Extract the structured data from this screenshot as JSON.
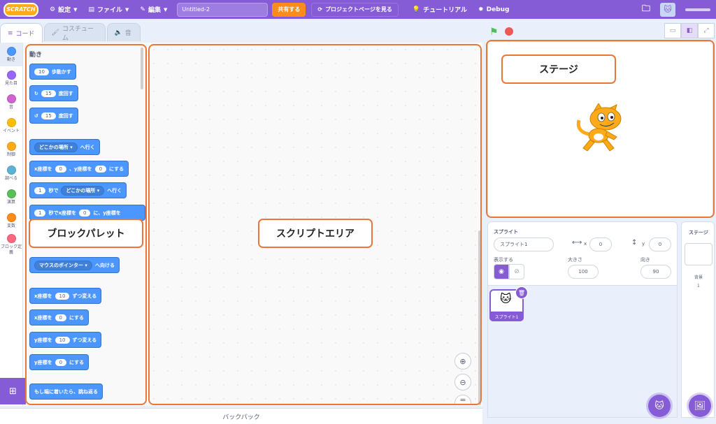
{
  "menubar": {
    "logo": "SCRATCH",
    "settings": "設定",
    "file": "ファイル",
    "edit": "編集",
    "project_title": "Untitled-2",
    "share": "共有する",
    "project_page": "プロジェクトページを見る",
    "tutorial": "チュートリアル",
    "debug": "Debug",
    "accent_color": "#855cd6"
  },
  "tabs": [
    {
      "label": "コード",
      "active": true
    },
    {
      "label": "コスチューム",
      "active": false
    },
    {
      "label": "音",
      "active": false
    }
  ],
  "categories": [
    {
      "label": "動き",
      "color": "#4c97ff"
    },
    {
      "label": "見た目",
      "color": "#9966ff"
    },
    {
      "label": "音",
      "color": "#cf63cf"
    },
    {
      "label": "イベント",
      "color": "#ffbf00"
    },
    {
      "label": "制御",
      "color": "#ffab19"
    },
    {
      "label": "調べる",
      "color": "#5cb1d6"
    },
    {
      "label": "演算",
      "color": "#59c059"
    },
    {
      "label": "変数",
      "color": "#ff8c1a"
    },
    {
      "label": "ブロック定義",
      "color": "#ff6680"
    }
  ],
  "palette": {
    "section_title": "動き",
    "blocks": {
      "move": {
        "value": "10",
        "text": "歩動かす"
      },
      "turn_right": {
        "value": "15",
        "text": "度回す"
      },
      "turn_left": {
        "value": "15",
        "text": "度回す"
      },
      "goto": {
        "drop": "どこかの場所",
        "text": "へ行く"
      },
      "goto_xy": {
        "pre": "x座標を",
        "x": "0",
        "mid": "、y座標を",
        "y": "0",
        "post": "にする"
      },
      "glide": {
        "value": "1",
        "mid": "秒で",
        "drop": "どこかの場所",
        "post": "へ行く"
      },
      "glide_xy": {
        "value": "1",
        "mid": "秒でx座標を",
        "x": "0",
        "post": "に、y座標を"
      },
      "point_towards": {
        "drop": "マウスのポインター",
        "text": "へ向ける"
      },
      "change_x": {
        "pre": "x座標を",
        "value": "10",
        "post": "ずつ変える"
      },
      "set_x": {
        "pre": "x座標を",
        "value": "0",
        "post": "にする"
      },
      "change_y": {
        "pre": "y座標を",
        "value": "10",
        "post": "ずつ変える"
      },
      "set_y": {
        "pre": "y座標を",
        "value": "0",
        "post": "にする"
      },
      "bounce": {
        "text": "もし端に着いたら、跳ね返る"
      }
    }
  },
  "backpack": "バックパック",
  "sprite_info": {
    "sprite_label": "スプライト",
    "sprite_name": "スプライト1",
    "x_label": "x",
    "x_value": "0",
    "y_label": "y",
    "y_value": "0",
    "show_label": "表示する",
    "size_label": "大きさ",
    "size_value": "100",
    "direction_label": "向き",
    "direction_value": "90"
  },
  "sprite_tile_name": "スプライト1",
  "stage_pane": {
    "title": "ステージ",
    "backdrop_label": "背景",
    "backdrop_count": "1"
  },
  "annotations": {
    "stage": "ステージ",
    "palette": "ブロックパレット",
    "script_area": "スクリプトエリア"
  }
}
